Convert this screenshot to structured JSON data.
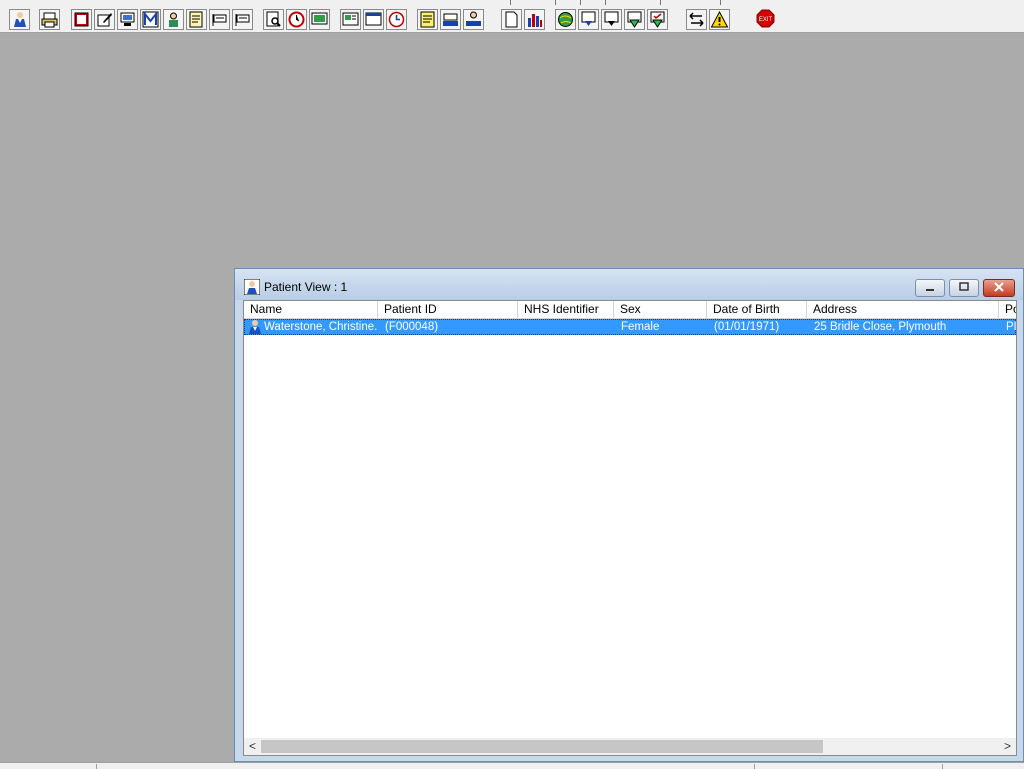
{
  "toolbar": {
    "buttons": [
      {
        "icon": "patient-icon",
        "x_hint": "a"
      },
      {
        "icon": "printer-icon"
      },
      {
        "icon": "book-icon"
      },
      {
        "icon": "edit-note-icon"
      },
      {
        "icon": "computer-icon"
      },
      {
        "icon": "letter-m-icon",
        "label": "M"
      },
      {
        "icon": "doctor-icon"
      },
      {
        "icon": "notepad-icon"
      },
      {
        "icon": "flag-icon"
      },
      {
        "icon": "flag-alt-icon"
      },
      {
        "icon": "search-document-icon"
      },
      {
        "icon": "clock-icon"
      },
      {
        "icon": "monitor-icon"
      },
      {
        "icon": "chart-card-icon"
      },
      {
        "icon": "window-card-icon"
      },
      {
        "icon": "history-icon"
      },
      {
        "icon": "notes-icon"
      },
      {
        "icon": "inbox-tray-icon"
      },
      {
        "icon": "user-tray-icon"
      },
      {
        "icon": "blank-document-icon"
      },
      {
        "icon": "bar-chart-icon"
      },
      {
        "icon": "globe-icon"
      },
      {
        "icon": "document-down-icon"
      },
      {
        "icon": "document-down-alt-icon"
      },
      {
        "icon": "green-down-arrow-icon"
      },
      {
        "icon": "green-check-arrow-icon"
      },
      {
        "icon": "swap-arrows-icon"
      },
      {
        "icon": "warning-icon"
      },
      {
        "icon": "exit-icon",
        "label": "EXIT"
      }
    ]
  },
  "window": {
    "title": "Patient View : 1"
  },
  "list": {
    "columns": [
      "Name",
      "Patient ID",
      "NHS Identifier",
      "Sex",
      "Date of Birth",
      "Address",
      "Po"
    ],
    "rows": [
      {
        "name": "Waterstone, Christine...",
        "patient_id": "(F000048)",
        "nhs_identifier": "",
        "sex": "Female",
        "dob": "(01/01/1971)",
        "address": "25 Bridle Close, Plymouth",
        "postcode": "PL"
      }
    ]
  },
  "scrollbar": {
    "left_arrow": "<",
    "right_arrow": ">"
  },
  "colors": {
    "selection": "#3399ff",
    "desktop": "#ababab"
  }
}
